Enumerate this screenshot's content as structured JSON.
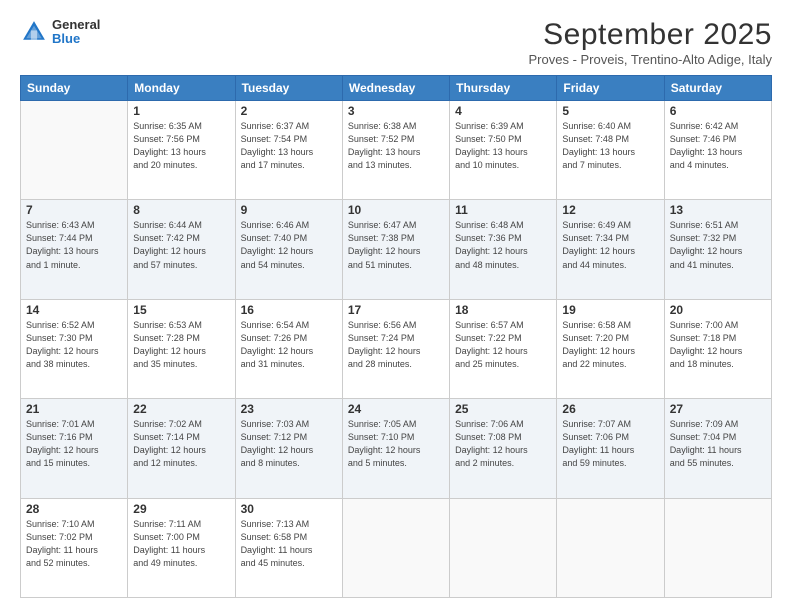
{
  "logo": {
    "general": "General",
    "blue": "Blue"
  },
  "header": {
    "month": "September 2025",
    "location": "Proves - Proveis, Trentino-Alto Adige, Italy"
  },
  "weekdays": [
    "Sunday",
    "Monday",
    "Tuesday",
    "Wednesday",
    "Thursday",
    "Friday",
    "Saturday"
  ],
  "weeks": [
    [
      {
        "day": "",
        "text": ""
      },
      {
        "day": "1",
        "text": "Sunrise: 6:35 AM\nSunset: 7:56 PM\nDaylight: 13 hours\nand 20 minutes."
      },
      {
        "day": "2",
        "text": "Sunrise: 6:37 AM\nSunset: 7:54 PM\nDaylight: 13 hours\nand 17 minutes."
      },
      {
        "day": "3",
        "text": "Sunrise: 6:38 AM\nSunset: 7:52 PM\nDaylight: 13 hours\nand 13 minutes."
      },
      {
        "day": "4",
        "text": "Sunrise: 6:39 AM\nSunset: 7:50 PM\nDaylight: 13 hours\nand 10 minutes."
      },
      {
        "day": "5",
        "text": "Sunrise: 6:40 AM\nSunset: 7:48 PM\nDaylight: 13 hours\nand 7 minutes."
      },
      {
        "day": "6",
        "text": "Sunrise: 6:42 AM\nSunset: 7:46 PM\nDaylight: 13 hours\nand 4 minutes."
      }
    ],
    [
      {
        "day": "7",
        "text": "Sunrise: 6:43 AM\nSunset: 7:44 PM\nDaylight: 13 hours\nand 1 minute."
      },
      {
        "day": "8",
        "text": "Sunrise: 6:44 AM\nSunset: 7:42 PM\nDaylight: 12 hours\nand 57 minutes."
      },
      {
        "day": "9",
        "text": "Sunrise: 6:46 AM\nSunset: 7:40 PM\nDaylight: 12 hours\nand 54 minutes."
      },
      {
        "day": "10",
        "text": "Sunrise: 6:47 AM\nSunset: 7:38 PM\nDaylight: 12 hours\nand 51 minutes."
      },
      {
        "day": "11",
        "text": "Sunrise: 6:48 AM\nSunset: 7:36 PM\nDaylight: 12 hours\nand 48 minutes."
      },
      {
        "day": "12",
        "text": "Sunrise: 6:49 AM\nSunset: 7:34 PM\nDaylight: 12 hours\nand 44 minutes."
      },
      {
        "day": "13",
        "text": "Sunrise: 6:51 AM\nSunset: 7:32 PM\nDaylight: 12 hours\nand 41 minutes."
      }
    ],
    [
      {
        "day": "14",
        "text": "Sunrise: 6:52 AM\nSunset: 7:30 PM\nDaylight: 12 hours\nand 38 minutes."
      },
      {
        "day": "15",
        "text": "Sunrise: 6:53 AM\nSunset: 7:28 PM\nDaylight: 12 hours\nand 35 minutes."
      },
      {
        "day": "16",
        "text": "Sunrise: 6:54 AM\nSunset: 7:26 PM\nDaylight: 12 hours\nand 31 minutes."
      },
      {
        "day": "17",
        "text": "Sunrise: 6:56 AM\nSunset: 7:24 PM\nDaylight: 12 hours\nand 28 minutes."
      },
      {
        "day": "18",
        "text": "Sunrise: 6:57 AM\nSunset: 7:22 PM\nDaylight: 12 hours\nand 25 minutes."
      },
      {
        "day": "19",
        "text": "Sunrise: 6:58 AM\nSunset: 7:20 PM\nDaylight: 12 hours\nand 22 minutes."
      },
      {
        "day": "20",
        "text": "Sunrise: 7:00 AM\nSunset: 7:18 PM\nDaylight: 12 hours\nand 18 minutes."
      }
    ],
    [
      {
        "day": "21",
        "text": "Sunrise: 7:01 AM\nSunset: 7:16 PM\nDaylight: 12 hours\nand 15 minutes."
      },
      {
        "day": "22",
        "text": "Sunrise: 7:02 AM\nSunset: 7:14 PM\nDaylight: 12 hours\nand 12 minutes."
      },
      {
        "day": "23",
        "text": "Sunrise: 7:03 AM\nSunset: 7:12 PM\nDaylight: 12 hours\nand 8 minutes."
      },
      {
        "day": "24",
        "text": "Sunrise: 7:05 AM\nSunset: 7:10 PM\nDaylight: 12 hours\nand 5 minutes."
      },
      {
        "day": "25",
        "text": "Sunrise: 7:06 AM\nSunset: 7:08 PM\nDaylight: 12 hours\nand 2 minutes."
      },
      {
        "day": "26",
        "text": "Sunrise: 7:07 AM\nSunset: 7:06 PM\nDaylight: 11 hours\nand 59 minutes."
      },
      {
        "day": "27",
        "text": "Sunrise: 7:09 AM\nSunset: 7:04 PM\nDaylight: 11 hours\nand 55 minutes."
      }
    ],
    [
      {
        "day": "28",
        "text": "Sunrise: 7:10 AM\nSunset: 7:02 PM\nDaylight: 11 hours\nand 52 minutes."
      },
      {
        "day": "29",
        "text": "Sunrise: 7:11 AM\nSunset: 7:00 PM\nDaylight: 11 hours\nand 49 minutes."
      },
      {
        "day": "30",
        "text": "Sunrise: 7:13 AM\nSunset: 6:58 PM\nDaylight: 11 hours\nand 45 minutes."
      },
      {
        "day": "",
        "text": ""
      },
      {
        "day": "",
        "text": ""
      },
      {
        "day": "",
        "text": ""
      },
      {
        "day": "",
        "text": ""
      }
    ]
  ]
}
